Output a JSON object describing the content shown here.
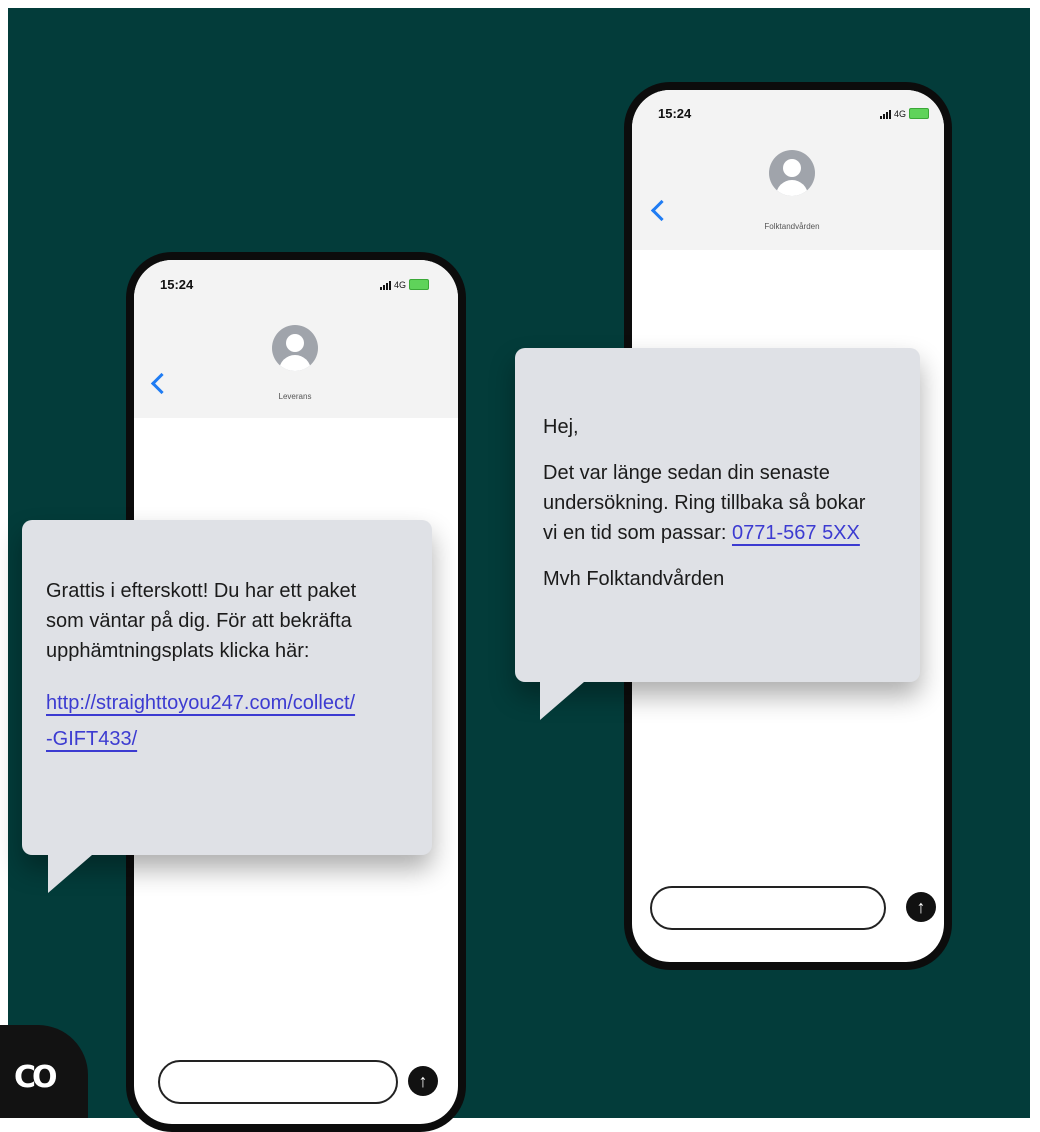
{
  "phones": {
    "left": {
      "time": "15:24",
      "network": "4G",
      "contact_name": "Leverans",
      "message": {
        "line1": "Grattis i efterskott! Du har ett paket",
        "line2": "som väntar på dig. För att bekräfta",
        "line3": "upphämtningsplats klicka här:",
        "link_line1": "http://straighttoyou247.com/collect/",
        "link_line2": "-GIFT433/"
      }
    },
    "right": {
      "time": "15:24",
      "network": "4G",
      "contact_name": "Folktandvården",
      "message": {
        "greeting": "Hej,",
        "line1": "Det var länge sedan din senaste",
        "line2": "undersökning. Ring tillbaka så bokar",
        "line3_prefix": "vi en tid som passar:",
        "phone_link": "0771-567 5XX",
        "signoff": "Mvh Folktandvården"
      }
    }
  },
  "logo": {
    "text": "CO"
  },
  "icons": {
    "back": "chevron-left-icon",
    "avatar": "person-avatar-icon",
    "send": "arrow-up-icon",
    "signal": "signal-bars-icon",
    "battery": "battery-icon"
  },
  "colors": {
    "background": "#033c3a",
    "bubble": "#dfe1e6",
    "link": "#3c3bd1",
    "ios_blue": "#1f7cf3",
    "battery": "#5fd35a"
  }
}
